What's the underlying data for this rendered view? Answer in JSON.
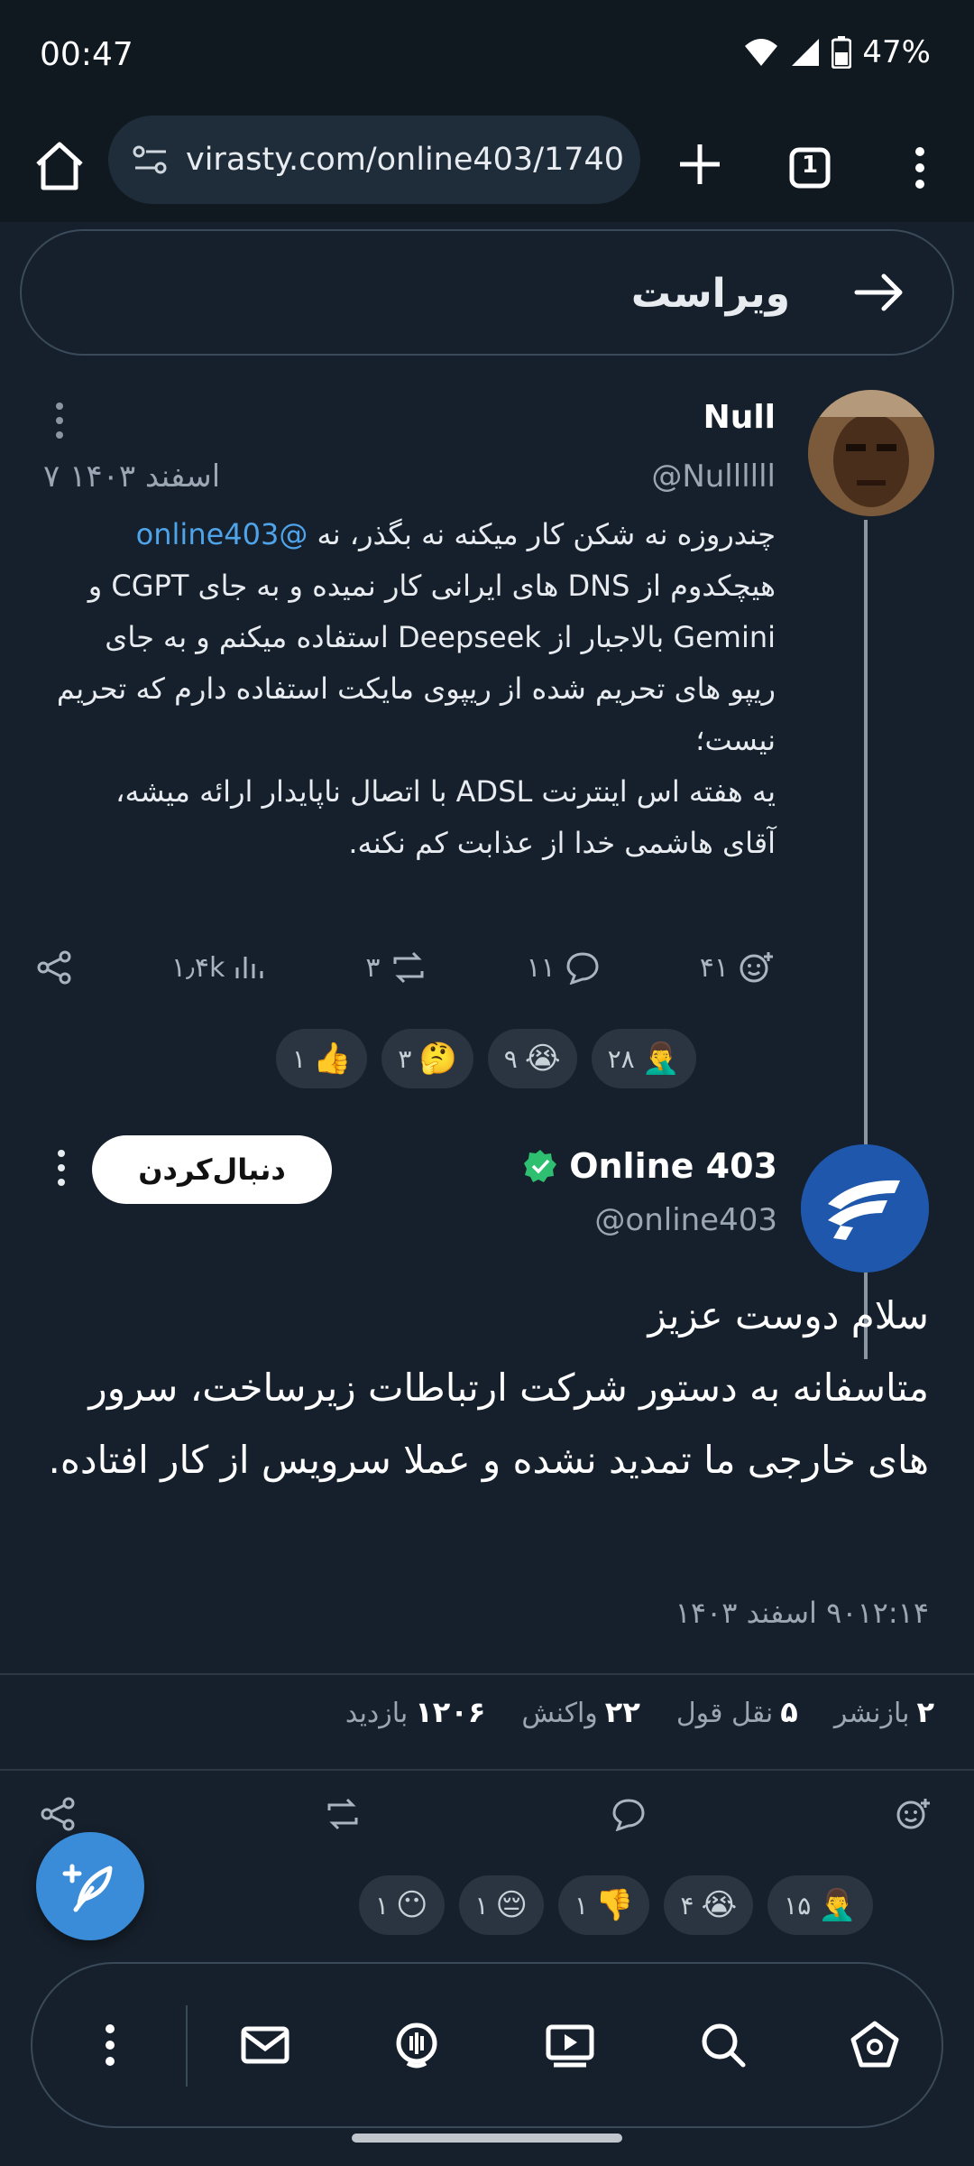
{
  "status_bar": {
    "time": "00:47",
    "battery": "47%"
  },
  "browser": {
    "url": "virasty.com/online403/1740",
    "tab_count": "1"
  },
  "header": {
    "title": "ویراست"
  },
  "post1": {
    "name": "Null",
    "handle": "@Nullllll",
    "date": "۷ اسفند ۱۴۰۳",
    "text_before_mention": "چندروزه نه شکن کار میکنه نه بگذر، نه ",
    "mention": "@online403",
    "text_after_mention": " هیچکدوم از DNS های ایرانی کار نمیده و به جای CGPT و Gemini بالاجبار از Deepseek استفاده میکنم و به جای ریپو های تحریم شده از ریپوی مایکت استفاده دارم که تحریم نیست؛",
    "text_line2": "یه هفته اس اینترنت ADSL با اتصال ناپایدار ارائه میشه، آقای هاشمی خدا از عذابت کم نکنه.",
    "views": "۱٫۴k",
    "reposts": "۳",
    "replies": "۱۱",
    "reactions": "۴۱",
    "reaction_chips": [
      {
        "emoji": "👍",
        "count": "۱"
      },
      {
        "emoji": "🤔",
        "count": "۳"
      },
      {
        "emoji": "😭",
        "count": "۹"
      },
      {
        "emoji": "🤦‍♂️",
        "count": "۲۸"
      }
    ]
  },
  "post2": {
    "name": "Online 403",
    "handle": "@online403",
    "follow_label": "دنبال‌کردن",
    "line1": "سلام دوست عزیز",
    "line2": "متاسفانه به دستور شرکت ارتباطات زیرساخت، سرور های خارجی ما تمدید نشده و عملا سرویس از کار افتاده.",
    "timestamp": "۹۰۱۲:۱۴ اسفند ۱۴۰۳",
    "stats": [
      {
        "value": "۲",
        "label": "بازنشر"
      },
      {
        "value": "۵",
        "label": "نقل قول"
      },
      {
        "value": "۲۲",
        "label": "واکنش"
      },
      {
        "value": "۱۲۰۶",
        "label": "بازدید"
      }
    ],
    "reaction_chips": [
      {
        "emoji": "😶",
        "count": "۱"
      },
      {
        "emoji": "😔",
        "count": "۱"
      },
      {
        "emoji": "👎",
        "count": "۱"
      },
      {
        "emoji": "😭",
        "count": "۴"
      },
      {
        "emoji": "🤦‍♂️",
        "count": "۱۵"
      }
    ]
  }
}
